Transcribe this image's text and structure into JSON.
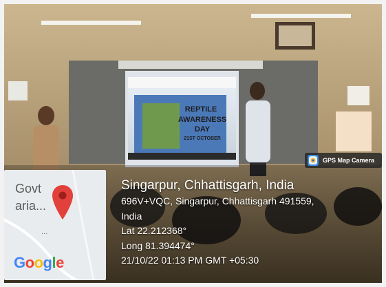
{
  "photo": {
    "scene": "classroom presentation with two presenters beside a projected slide",
    "slide_lines": [
      "REPTILE",
      "AWARENESS",
      "DAY",
      "21ST OCTOBER"
    ]
  },
  "map_thumbnail": {
    "label_line1": "Govt",
    "label_line2": "aria...",
    "dots": "...",
    "logo_text": "Google",
    "pin_color": "#e2403a"
  },
  "badge": {
    "text": "GPS Map Camera",
    "icon": "gps-map-camera-icon"
  },
  "location": {
    "title": "Singarpur, Chhattisgarh, India",
    "address_line1": "696V+VQC, Singarpur, Chhattisgarh 491559,",
    "address_line2": "India",
    "lat": "Lat 22.212368°",
    "long": "Long 81.394474°",
    "timestamp": "21/10/22 01:13 PM GMT +05:30"
  },
  "colors": {
    "google_blue": "#4285f4",
    "google_red": "#ea4335",
    "google_yellow": "#fbbc05",
    "google_green": "#34a853"
  }
}
